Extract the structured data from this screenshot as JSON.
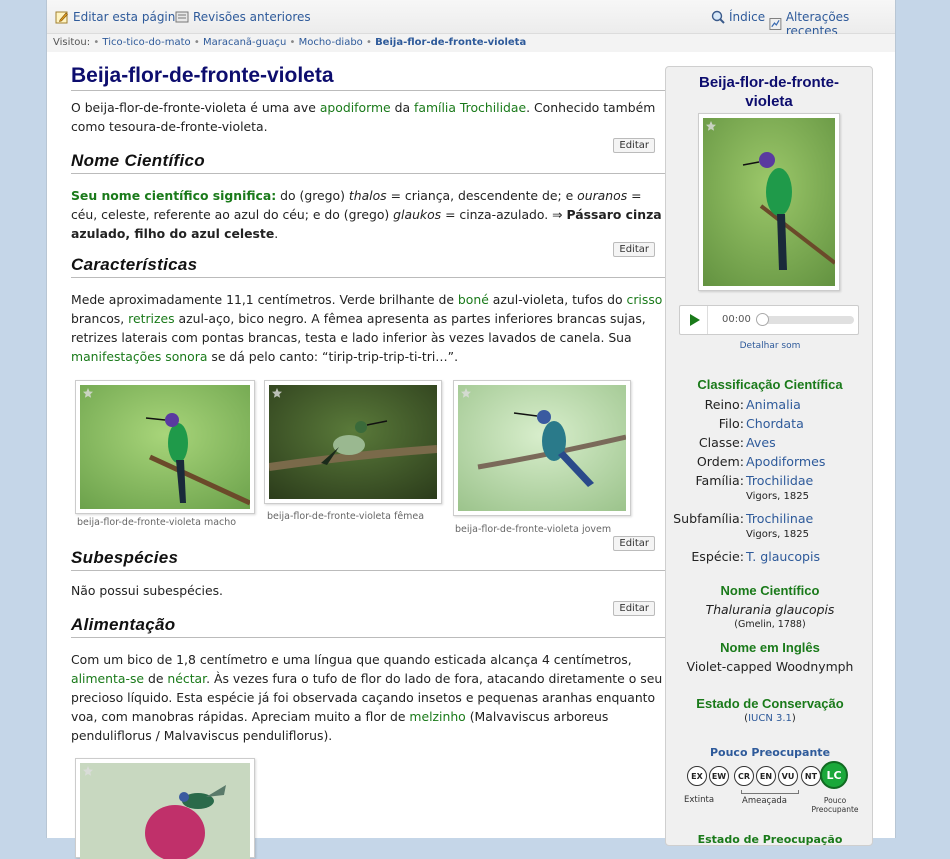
{
  "toolbar": {
    "edit_label": "Editar esta página",
    "revisions_label": "Revisões anteriores",
    "index_label": "Índice",
    "recent_label": "Alterações recentes"
  },
  "visited": {
    "label": "Visitou:",
    "items": [
      "Tico-tico-do-mato",
      "Maracanã-guaçu",
      "Mocho-diabo",
      "Beija-flor-de-fronte-violeta"
    ]
  },
  "article": {
    "title": "Beija-flor-de-fronte-violeta",
    "intro": {
      "t1": "O beija-flor-de-fronte-violeta é uma ave ",
      "l1": "apodiforme",
      "t2": " da ",
      "l2": "família Trochilidae",
      "t3": ". Conhecido também como tesoura-de-fronte-violeta."
    },
    "edit_label": "Editar",
    "sci_section": {
      "heading": "Nome Científico",
      "lead": "Seu nome científico significa:",
      "t1": " do (grego) ",
      "i1": "thalos",
      "t2": " = criança, descendente de; e ",
      "i2": "ouranos",
      "t3": " = céu, celeste, referente ao azul do céu; e do (grego) ",
      "i3": "glaukos",
      "t4": " = cinza-azulado. ⇒ ",
      "bold": "Pássaro cinza azulado, filho do azul celeste",
      "t5": "."
    },
    "char_section": {
      "heading": "Características",
      "t1": "Mede aproximadamente 11,1 centímetros. Verde brilhante de ",
      "l1": "boné",
      "t2": " azul-violeta, tufos do ",
      "l2": "crisso",
      "t3": " brancos, ",
      "l3": "retrizes",
      "t4": " azul-aço, bico negro. A fêmea apresenta as partes inferiores brancas sujas, retrizes laterais com pontas brancas, testa e lado inferior às vezes lavados de canela. Sua ",
      "l4": "manifestações sonora",
      "t5": " se dá pelo canto: “tirip-trip-trip-ti-tri…”."
    },
    "gallery": [
      {
        "caption": "beija-flor-de-fronte-violeta macho"
      },
      {
        "caption": "beija-flor-de-fronte-violeta fêmea"
      },
      {
        "caption": "beija-flor-de-fronte-violeta jovem"
      }
    ],
    "subspecies": {
      "heading": "Subespécies",
      "text": "Não possui subespécies."
    },
    "food": {
      "heading": "Alimentação",
      "t1": "Com um bico de 1,8 centímetro e uma língua que quando esticada alcança 4 centímetros, ",
      "l1": "alimenta-se",
      "t2": " de ",
      "l2": "néctar",
      "t3": ". Às vezes fura o tufo de flor do lado de fora, atacando diretamente o seu precioso líquido. Esta espécie já foi observada caçando insetos e pequenas aranhas enquanto voa, com manobras rápidas. Apreciam muito a flor de ",
      "l3": "melzinho",
      "t4": " (Malvaviscus arboreus penduliflorus / Malvaviscus penduliflorus)."
    }
  },
  "infobox": {
    "title": "Beija-flor-de-fronte-violeta",
    "audio": {
      "time": "00:00",
      "detail_label": "Detalhar som"
    },
    "classification_heading": "Classificação Científica",
    "taxonomy": [
      {
        "rank": "Reino:",
        "name": "Animalia",
        "author": ""
      },
      {
        "rank": "Filo:",
        "name": "Chordata",
        "author": ""
      },
      {
        "rank": "Classe:",
        "name": "Aves",
        "author": ""
      },
      {
        "rank": "Ordem:",
        "name": "Apodiformes",
        "author": ""
      },
      {
        "rank": "Família:",
        "name": "Trochilidae",
        "author": "Vigors, 1825"
      },
      {
        "rank": "Subfamília:",
        "name": "Trochilinae",
        "author": "Vigors, 1825"
      },
      {
        "rank": "Espécie:",
        "name": "T. glaucopis",
        "author": ""
      }
    ],
    "sci_name_heading": "Nome Científico",
    "sci_name": "Thalurania glaucopis",
    "sci_author": "(Gmelin, 1788)",
    "english_heading": "Nome em Inglês",
    "english_name": "Violet-capped Woodnymph",
    "conservation_heading": "Estado de Conservação",
    "iucn_open": "(",
    "iucn_link": "IUCN 3.1",
    "iucn_close": ")",
    "status_label": "Pouco Preocupante",
    "statuses": [
      "EX",
      "EW",
      "CR",
      "EN",
      "VU",
      "NT",
      "LC"
    ],
    "legend": {
      "extinct": "Extinta",
      "threatened": "Ameaçada",
      "least1": "Pouco",
      "least2": "Preocupante"
    },
    "bottom_partial": "Estado de Preocupação"
  }
}
